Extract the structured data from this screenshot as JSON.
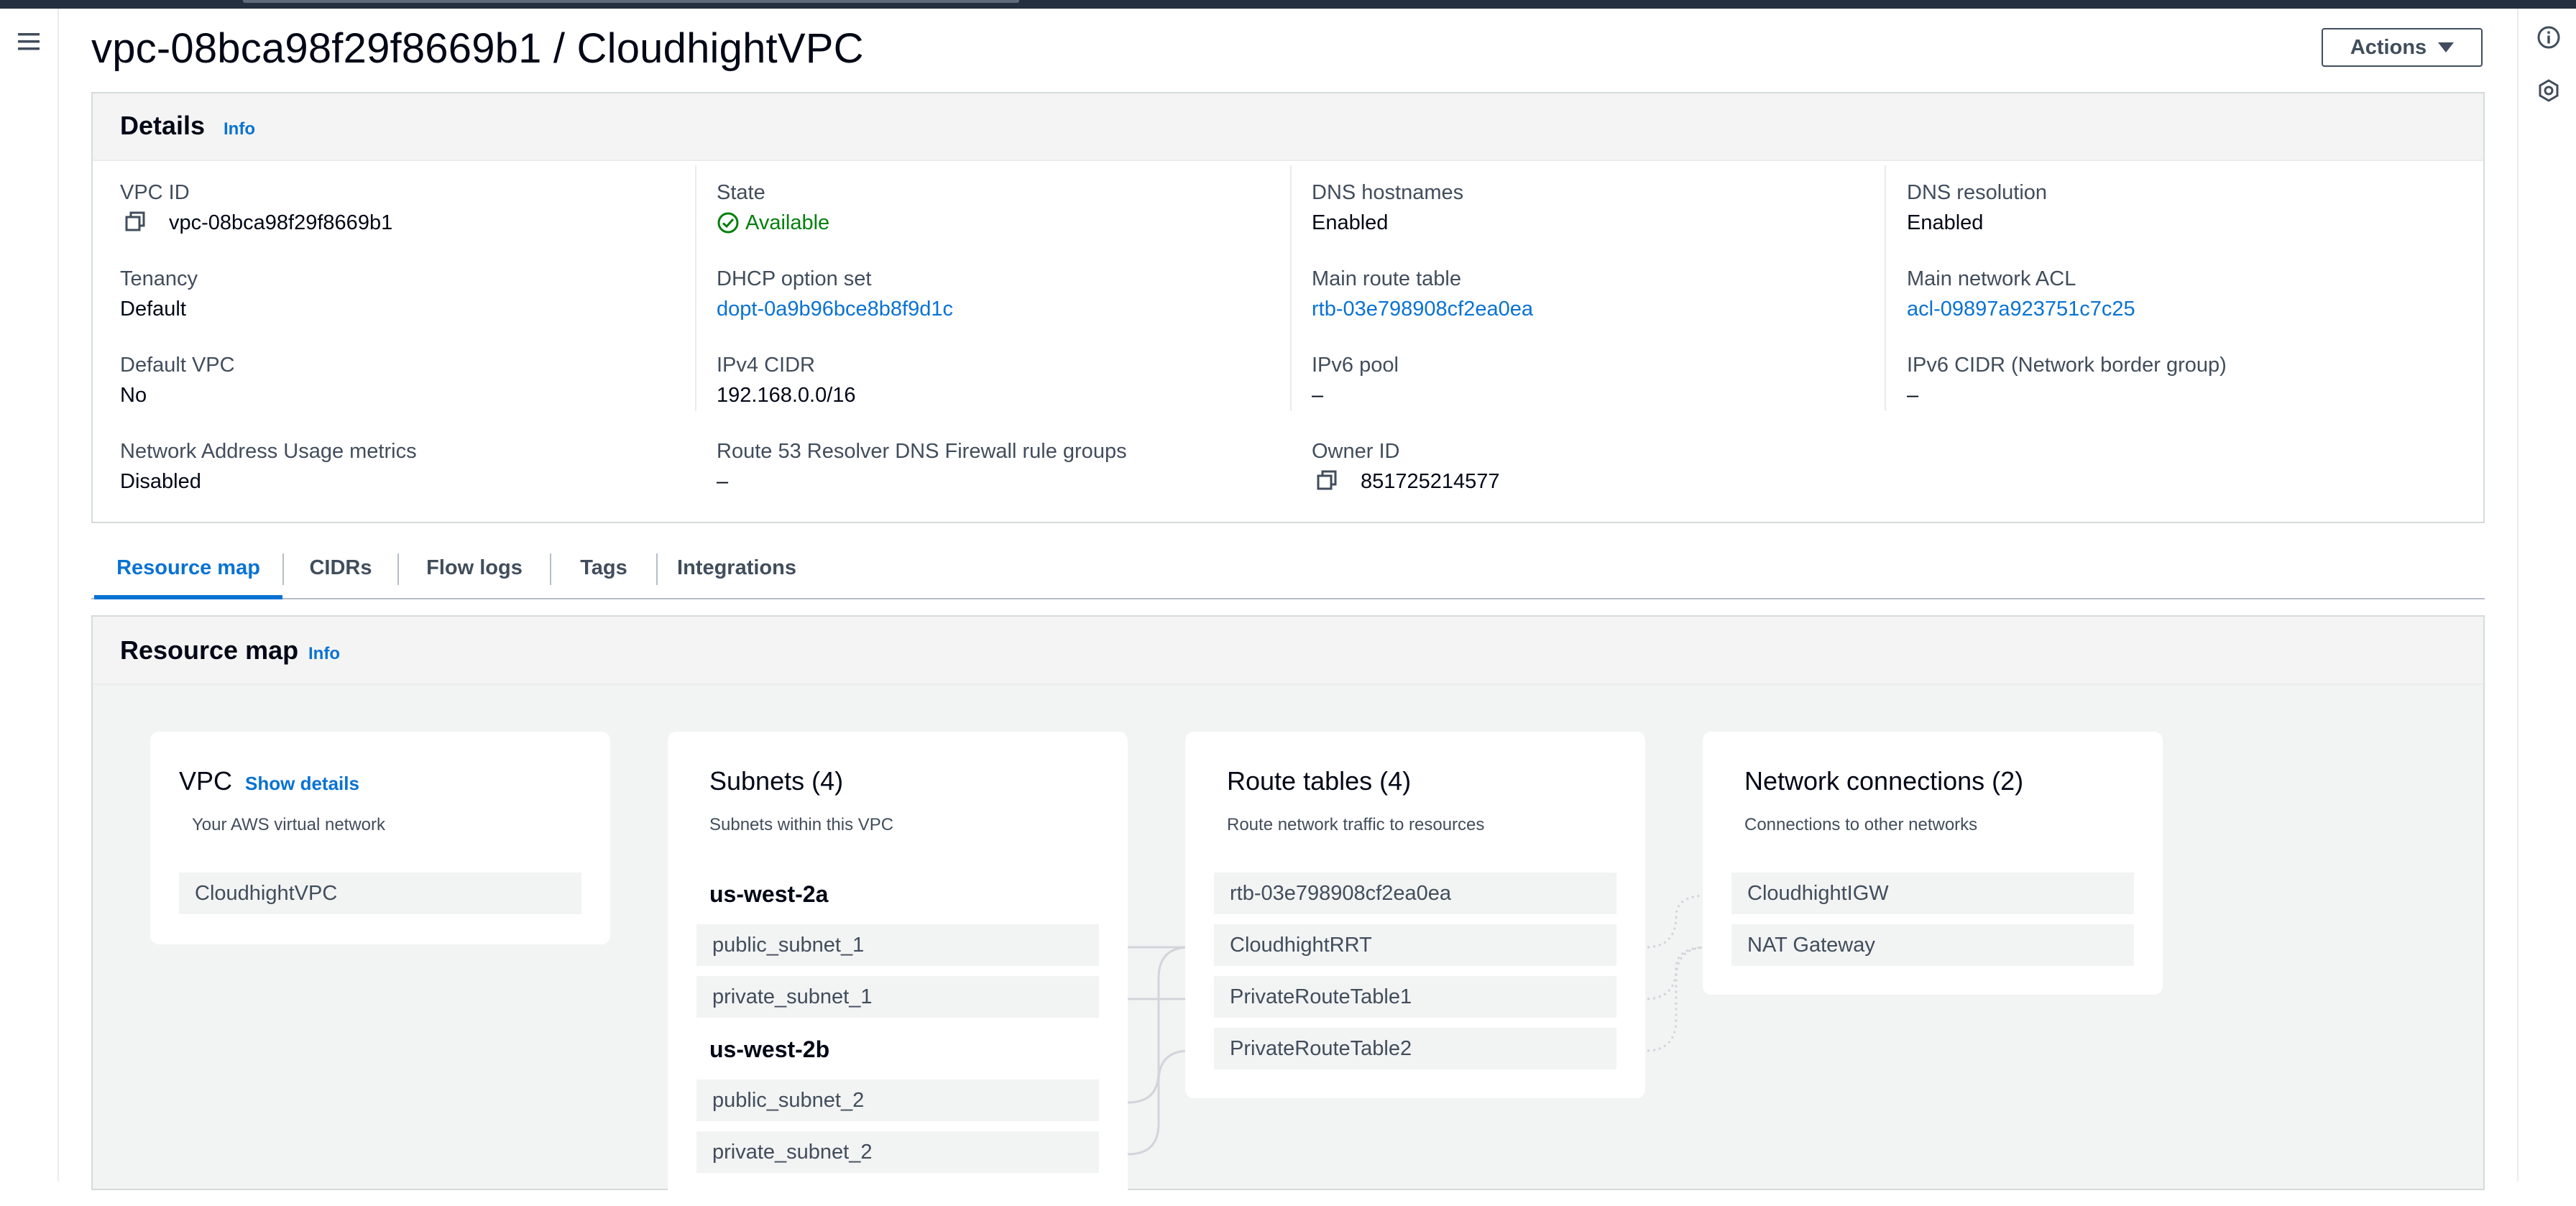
{
  "page": {
    "title": "vpc-08bca98f29f8669b1 / CloudhightVPC",
    "actions_label": "Actions"
  },
  "icons": {
    "menu": "hamburger-menu-icon",
    "info": "info-circle-icon",
    "feedback": "settings-hexagon-icon"
  },
  "details": {
    "title": "Details",
    "info": "Info",
    "columns": [
      [
        {
          "label": "VPC ID",
          "value": "vpc-08bca98f29f8669b1"
        },
        {
          "label": "Tenancy",
          "value": "Default"
        },
        {
          "label": "Default VPC",
          "value": "No"
        },
        {
          "label": "Network Address Usage metrics",
          "value": "Disabled"
        }
      ],
      [
        {
          "label": "State",
          "value": "Available"
        },
        {
          "label": "DHCP option set",
          "value": "dopt-0a9b96bce8b8f9d1c"
        },
        {
          "label": "IPv4 CIDR",
          "value": "192.168.0.0/16"
        },
        {
          "label": "Route 53 Resolver DNS Firewall rule groups",
          "value": "–"
        }
      ],
      [
        {
          "label": "DNS hostnames",
          "value": "Enabled"
        },
        {
          "label": "Main route table",
          "value": "rtb-03e798908cf2ea0ea"
        },
        {
          "label": "IPv6 pool",
          "value": "–"
        },
        {
          "label": "Owner ID",
          "value": "851725214577"
        }
      ],
      [
        {
          "label": "DNS resolution",
          "value": "Enabled"
        },
        {
          "label": "Main network ACL",
          "value": "acl-09897a923751c7c25"
        },
        {
          "label": "IPv6 CIDR (Network border group)",
          "value": "–"
        }
      ]
    ]
  },
  "tabs": [
    "Resource map",
    "CIDRs",
    "Flow logs",
    "Tags",
    "Integrations"
  ],
  "resource_map": {
    "title": "Resource map",
    "info": "Info",
    "vpc": {
      "title": "VPC",
      "show_details": "Show details",
      "subtitle": "Your AWS virtual network",
      "items": [
        "CloudhightVPC"
      ]
    },
    "subnets": {
      "title": "Subnets (4)",
      "subtitle": "Subnets within this VPC",
      "zones": [
        {
          "name": "us-west-2a",
          "items": [
            "public_subnet_1",
            "private_subnet_1"
          ]
        },
        {
          "name": "us-west-2b",
          "items": [
            "public_subnet_2",
            "private_subnet_2"
          ]
        }
      ]
    },
    "route_tables": {
      "title": "Route tables (4)",
      "subtitle": "Route network traffic to resources",
      "items": [
        "rtb-03e798908cf2ea0ea",
        "CloudhightRRT",
        "PrivateRouteTable1",
        "PrivateRouteTable2"
      ]
    },
    "network_connections": {
      "title": "Network connections (2)",
      "subtitle": "Connections to other networks",
      "items": [
        "CloudhightIGW",
        "NAT Gateway"
      ]
    }
  }
}
